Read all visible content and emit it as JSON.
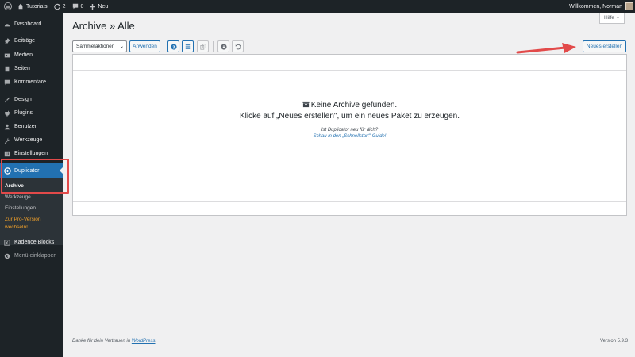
{
  "adminbar": {
    "site_name": "Tutorials",
    "updates_count": "2",
    "comments_count": "0",
    "new_label": "Neu",
    "greeting": "Willkommen, Norman"
  },
  "sidebar": {
    "items": [
      {
        "label": "Dashboard",
        "icon": "dashboard-icon"
      },
      {
        "label": "Beiträge",
        "icon": "pin-icon"
      },
      {
        "label": "Medien",
        "icon": "media-icon"
      },
      {
        "label": "Seiten",
        "icon": "page-icon"
      },
      {
        "label": "Kommentare",
        "icon": "comment-icon"
      },
      {
        "label": "Design",
        "icon": "brush-icon"
      },
      {
        "label": "Plugins",
        "icon": "plugin-icon"
      },
      {
        "label": "Benutzer",
        "icon": "user-icon"
      },
      {
        "label": "Werkzeuge",
        "icon": "wrench-icon"
      },
      {
        "label": "Einstellungen",
        "icon": "settings-icon"
      },
      {
        "label": "Duplicator",
        "icon": "duplicator-icon"
      },
      {
        "label": "Kadence Blocks",
        "icon": "kadence-icon"
      },
      {
        "label": "Menü einklappen",
        "icon": "collapse-icon"
      }
    ],
    "submenu": [
      {
        "label": "Archive"
      },
      {
        "label": "Werkzeuge"
      },
      {
        "label": "Einstellungen"
      },
      {
        "label": "Zur Pro-Version wechseln!"
      }
    ]
  },
  "header": {
    "title": "Archive » Alle",
    "help_label": "Hilfe"
  },
  "toolbar": {
    "bulk_select": "Sammelaktionen",
    "apply_label": "Anwenden",
    "new_label": "Neues erstellen"
  },
  "empty": {
    "title": "Keine Archive gefunden.",
    "subtitle": "Klicke auf „Neues erstellen\", um ein neues Paket zu erzeugen.",
    "hint": "Ist Duplicator neu für dich?",
    "hint_link": "Schau in den „Schnellstart\"-Guide!"
  },
  "footer": {
    "thanks_prefix": "Danke für dein Vertrauen in ",
    "thanks_link": "WordPress",
    "thanks_suffix": ".",
    "version": "Version 5.9.3"
  },
  "colors": {
    "accent": "#2271b1",
    "sidebar_bg": "#1d2327",
    "highlight_red": "#e24a4a",
    "pro_orange": "#f0a02a"
  }
}
